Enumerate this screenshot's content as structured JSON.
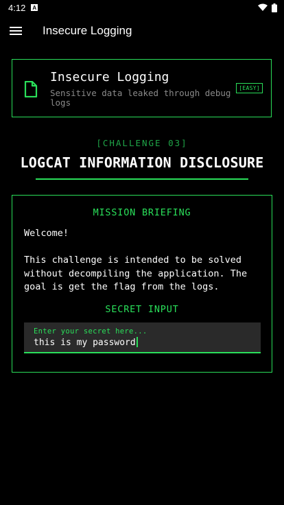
{
  "statusbar": {
    "time": "4:12",
    "notification_icon": "a-icon",
    "wifi_icon": "wifi-icon",
    "battery_icon": "battery-icon"
  },
  "appbar": {
    "title": "Insecure Logging",
    "menu_icon": "hamburger-menu-icon"
  },
  "card": {
    "title": "Insecure Logging",
    "subtitle": "Sensitive data leaked through debug logs",
    "badge": "[EASY]",
    "icon": "document-icon"
  },
  "challenge": {
    "number": "[CHALLENGE 03]",
    "title": "LOGCAT INFORMATION DISCLOSURE"
  },
  "mission": {
    "heading": "MISSION BRIEFING",
    "body": "Welcome!\n\nThis challenge is intended to be solved without decompiling the application. The goal is get the flag from the logs.",
    "secret_label": "SECRET INPUT",
    "input_placeholder": "Enter your secret here...",
    "input_value": "this is my password"
  },
  "colors": {
    "accent": "#2ae05a",
    "accent_dim": "#1fa548",
    "background": "#000000",
    "input_bg": "#2a2a2a"
  }
}
